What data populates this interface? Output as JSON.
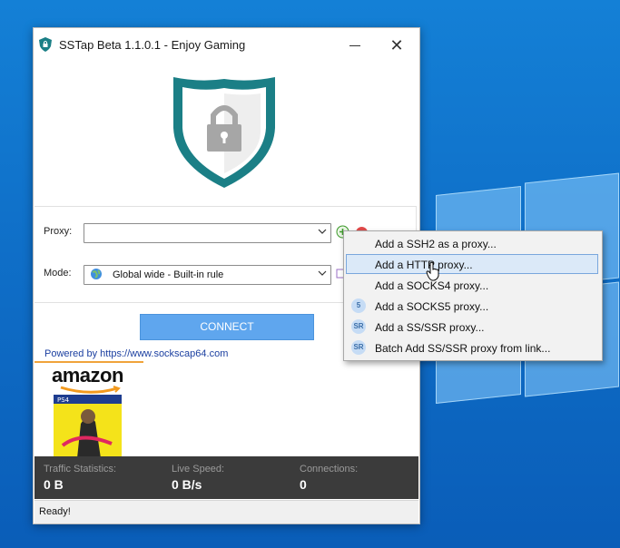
{
  "window": {
    "title": "SSTap Beta 1.1.0.1 - Enjoy Gaming"
  },
  "proxy": {
    "label": "Proxy:",
    "value": ""
  },
  "mode": {
    "label": "Mode:",
    "value": "Global wide - Built-in rule"
  },
  "connect_label": "CONNECT",
  "powered_by": "Powered by https://www.sockscap64.com",
  "ad": {
    "brand": "amazon"
  },
  "stats": {
    "traffic_label": "Traffic Statistics:",
    "traffic_value": "0 B",
    "speed_label": "Live Speed:",
    "speed_value": "0 B/s",
    "connections_label": "Connections:",
    "connections_value": "0"
  },
  "status": "Ready!",
  "menu": {
    "items": [
      {
        "label": "Add a SSH2 as a proxy...",
        "badge": ""
      },
      {
        "label": "Add a HTTP proxy...",
        "badge": ""
      },
      {
        "label": "Add a SOCKS4 proxy...",
        "badge": ""
      },
      {
        "label": "Add a SOCKS5 proxy...",
        "badge": "5"
      },
      {
        "label": "Add a SS/SSR proxy...",
        "badge": "SR"
      },
      {
        "label": "Batch Add SS/SSR proxy from link...",
        "badge": "SR"
      }
    ],
    "highlighted_index": 1
  },
  "colors": {
    "shield": "#1b7f86",
    "connect": "#5fa6ee",
    "stats_bg": "#3b3b3b",
    "desktop": "#1480d6"
  }
}
